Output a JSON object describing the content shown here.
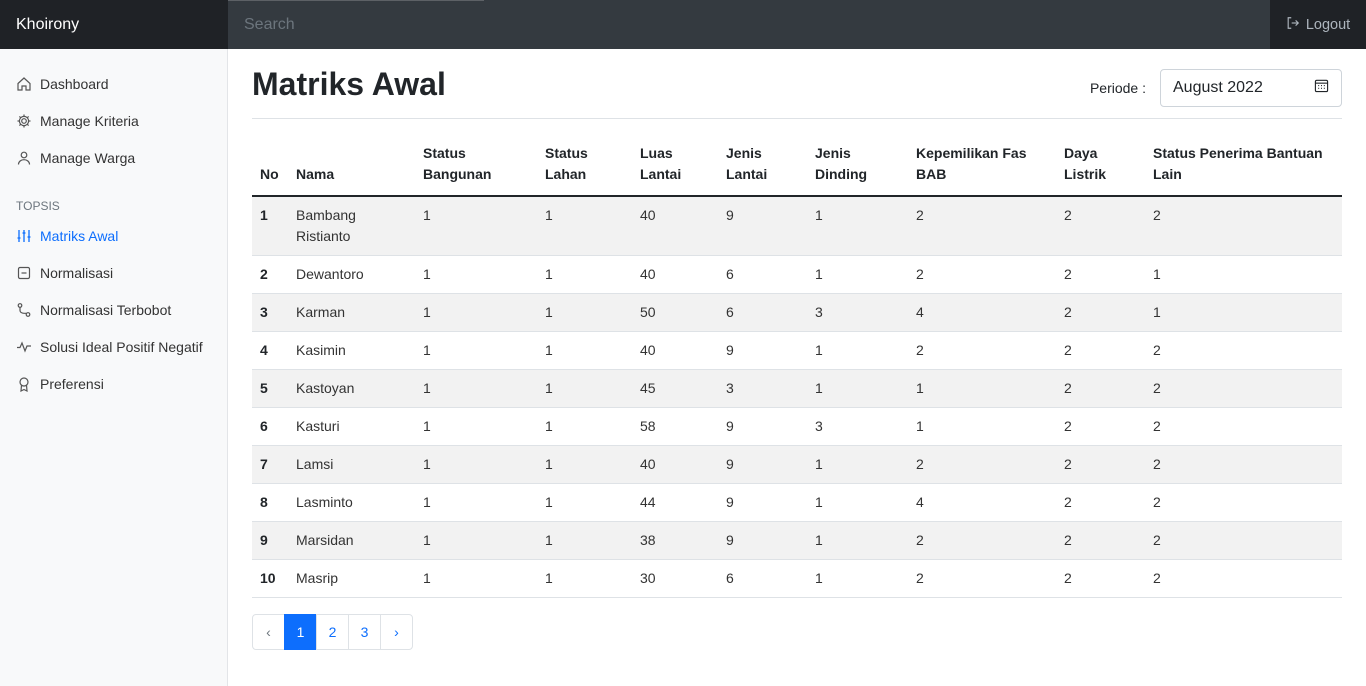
{
  "navbar": {
    "brand": "Khoirony",
    "search_placeholder": "Search",
    "logout_label": "Logout"
  },
  "sidebar": {
    "items": [
      {
        "label": "Dashboard",
        "icon": "house-icon"
      },
      {
        "label": "Manage Kriteria",
        "icon": "gear-icon"
      },
      {
        "label": "Manage Warga",
        "icon": "person-icon"
      }
    ],
    "heading": "TOPSIS",
    "topsis_items": [
      {
        "label": "Matriks Awal",
        "icon": "sliders-icon",
        "active": true
      },
      {
        "label": "Normalisasi",
        "icon": "document-icon"
      },
      {
        "label": "Normalisasi Terbobot",
        "icon": "bezier-icon"
      },
      {
        "label": "Solusi Ideal Positif Negatif",
        "icon": "activity-icon"
      },
      {
        "label": "Preferensi",
        "icon": "award-icon"
      }
    ]
  },
  "main": {
    "title": "Matriks Awal",
    "periode_label": "Periode :",
    "periode_value": "August 2022"
  },
  "table": {
    "headers": [
      "No",
      "Nama",
      "Status Bangunan",
      "Status Lahan",
      "Luas Lantai",
      "Jenis Lantai",
      "Jenis Dinding",
      "Kepemilikan Fas BAB",
      "Daya Listrik",
      "Status Penerima Bantuan Lain"
    ],
    "rows": [
      [
        "1",
        "Bambang Ristianto",
        "1",
        "1",
        "40",
        "9",
        "1",
        "2",
        "2",
        "2"
      ],
      [
        "2",
        "Dewantoro",
        "1",
        "1",
        "40",
        "6",
        "1",
        "2",
        "2",
        "1"
      ],
      [
        "3",
        "Karman",
        "1",
        "1",
        "50",
        "6",
        "3",
        "4",
        "2",
        "1"
      ],
      [
        "4",
        "Kasimin",
        "1",
        "1",
        "40",
        "9",
        "1",
        "2",
        "2",
        "2"
      ],
      [
        "5",
        "Kastoyan",
        "1",
        "1",
        "45",
        "3",
        "1",
        "1",
        "2",
        "2"
      ],
      [
        "6",
        "Kasturi",
        "1",
        "1",
        "58",
        "9",
        "3",
        "1",
        "2",
        "2"
      ],
      [
        "7",
        "Lamsi",
        "1",
        "1",
        "40",
        "9",
        "1",
        "2",
        "2",
        "2"
      ],
      [
        "8",
        "Lasminto",
        "1",
        "1",
        "44",
        "9",
        "1",
        "4",
        "2",
        "2"
      ],
      [
        "9",
        "Marsidan",
        "1",
        "1",
        "38",
        "9",
        "1",
        "2",
        "2",
        "2"
      ],
      [
        "10",
        "Masrip",
        "1",
        "1",
        "30",
        "6",
        "1",
        "2",
        "2",
        "2"
      ]
    ]
  },
  "pagination": {
    "prev": "‹",
    "pages": [
      "1",
      "2",
      "3"
    ],
    "current": "1",
    "next": "›"
  },
  "colors": {
    "navbar": "#343a40",
    "brand_bg": "#1f2226",
    "accent": "#0d6efd",
    "sidebar_bg": "#f8f9fa",
    "striped_row": "#f2f2f2"
  }
}
